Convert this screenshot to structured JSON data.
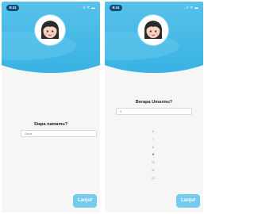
{
  "status_bar": {
    "time": "9:41",
    "indicators": "..il ᯤ ▬"
  },
  "screen_name": {
    "question": "Siapa namamu?",
    "input_value": "Gena",
    "continue_label": "Lanjut"
  },
  "screen_age": {
    "question": "Berapa Umurmu?",
    "input_value": "9",
    "age_options": [
      "6",
      "7",
      "8",
      "9",
      "10",
      "11",
      "12"
    ],
    "selected_age": "9",
    "continue_label": "Lanjut"
  },
  "colors": {
    "header_gradient_top": "#5ec4ea",
    "header_gradient_bottom": "#38b3e4",
    "button": "#74cbee",
    "status_pill": "#0f4d7a"
  },
  "icons": {
    "avatar": "girl-avatar-icon"
  }
}
